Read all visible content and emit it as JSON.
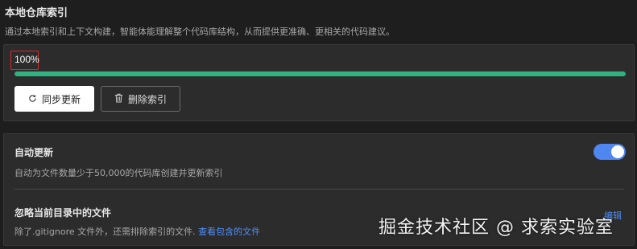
{
  "section": {
    "title": "本地仓库索引",
    "description": "通过本地索引和上下文构建，智能体能理解整个代码库结构，从而提供更准确、更相关的代码建议。"
  },
  "index": {
    "progress_label": "100%",
    "progress_value": 1.0,
    "progress_color": "#2fb380",
    "sync_button": {
      "label": "同步更新",
      "icon": "sync-icon"
    },
    "delete_button": {
      "label": "删除索引",
      "icon": "trash-icon"
    }
  },
  "settings": {
    "auto_update": {
      "title": "自动更新",
      "description": "自动为文件数量少于50,000的代码库创建并更新索引",
      "enabled": true,
      "toggle_color": "#4f86f0"
    },
    "ignore_files": {
      "title": "忽略当前目录中的文件",
      "description": "除了.gitignore 文件外，还需排除索引的文件.",
      "link_label": "查看包含的文件",
      "edit_label": "编辑"
    }
  },
  "watermark": "掘金技术社区 @ 求索实验室"
}
